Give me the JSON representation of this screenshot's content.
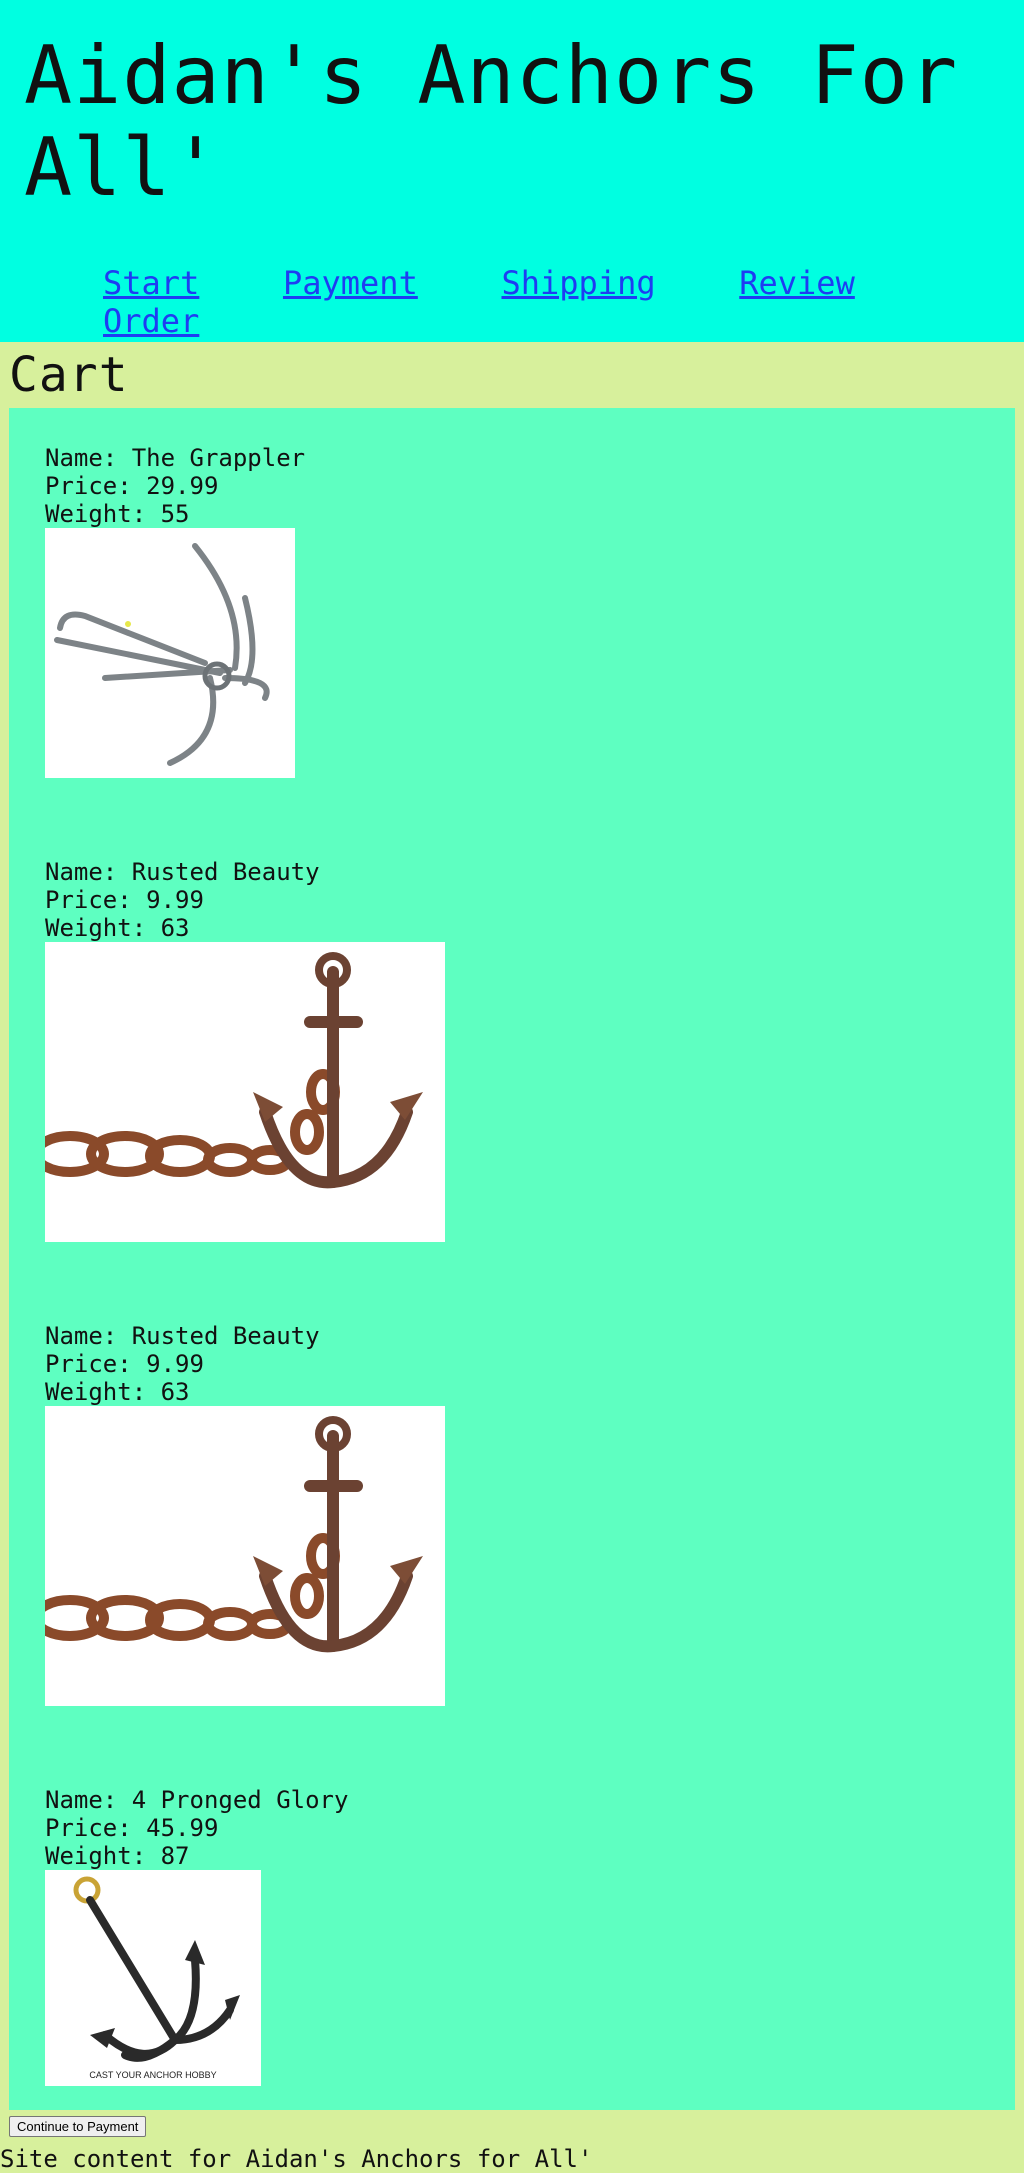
{
  "site": {
    "title": "Aidan's Anchors For All'"
  },
  "nav": {
    "links": [
      "Start",
      "Payment",
      "Shipping",
      "Review Order"
    ]
  },
  "cart": {
    "heading": "Cart",
    "items": [
      {
        "name": "Name: The Grappler",
        "price": "Price: 29.99",
        "weight": "Weight: 55",
        "image_icon": "grappling-anchor-icon"
      },
      {
        "name": "Name: Rusted Beauty",
        "price": "Price: 9.99",
        "weight": "Weight: 63",
        "image_icon": "rusted-anchor-chain-icon"
      },
      {
        "name": "Name: Rusted Beauty",
        "price": "Price: 9.99",
        "weight": "Weight: 63",
        "image_icon": "rusted-anchor-chain-icon"
      },
      {
        "name": "Name: 4 Pronged Glory",
        "price": "Price: 45.99",
        "weight": "Weight: 87",
        "image_icon": "four-pronged-anchor-icon",
        "image_caption": "CAST YOUR ANCHOR HOBBY"
      }
    ]
  },
  "actions": {
    "continue_label": "Continue to Payment"
  },
  "footer": {
    "text": "Site content for Aidan's Anchors for All'"
  },
  "colors": {
    "header_bg": "#00ffe1",
    "page_bg": "#d7f09c",
    "cart_bg": "#5effc1",
    "link": "#1e3df2"
  }
}
